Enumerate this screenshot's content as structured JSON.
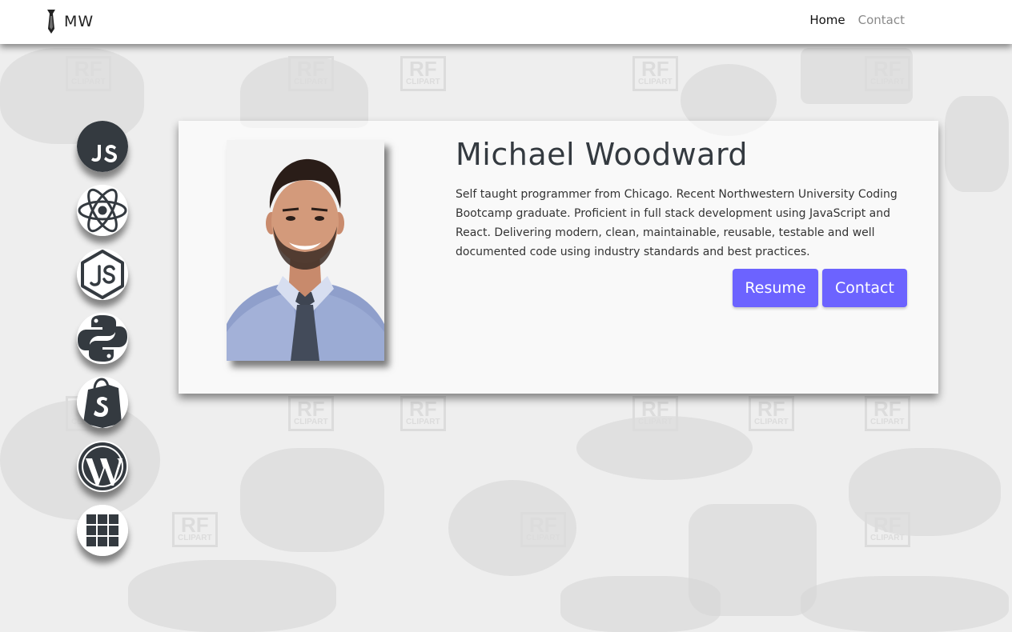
{
  "navbar": {
    "brand": "MW",
    "links": [
      {
        "label": "Home",
        "active": true
      },
      {
        "label": "Contact",
        "active": false
      }
    ]
  },
  "skills": [
    {
      "icon": "javascript-icon"
    },
    {
      "icon": "react-icon"
    },
    {
      "icon": "nodejs-icon"
    },
    {
      "icon": "python-icon"
    },
    {
      "icon": "shopify-icon"
    },
    {
      "icon": "wordpress-icon"
    },
    {
      "icon": "more-apps-grid-icon"
    }
  ],
  "profile": {
    "name": "Michael Woodward",
    "bio": "Self taught programmer from Chicago. Recent Northwestern University Coding Bootcamp graduate. Proficient in full stack development using JavaScript and React. Delivering modern, clean, maintainable, reusable, testable and well documented code using industry standards and best practices.",
    "buttons": {
      "resume": "Resume",
      "contact": "Contact"
    }
  },
  "colors": {
    "accent": "#6c63ff",
    "icon_dark": "#343a40",
    "background": "#eeeeee"
  },
  "background_watermark": {
    "line1": "RF",
    "line2": "CLIPART"
  }
}
